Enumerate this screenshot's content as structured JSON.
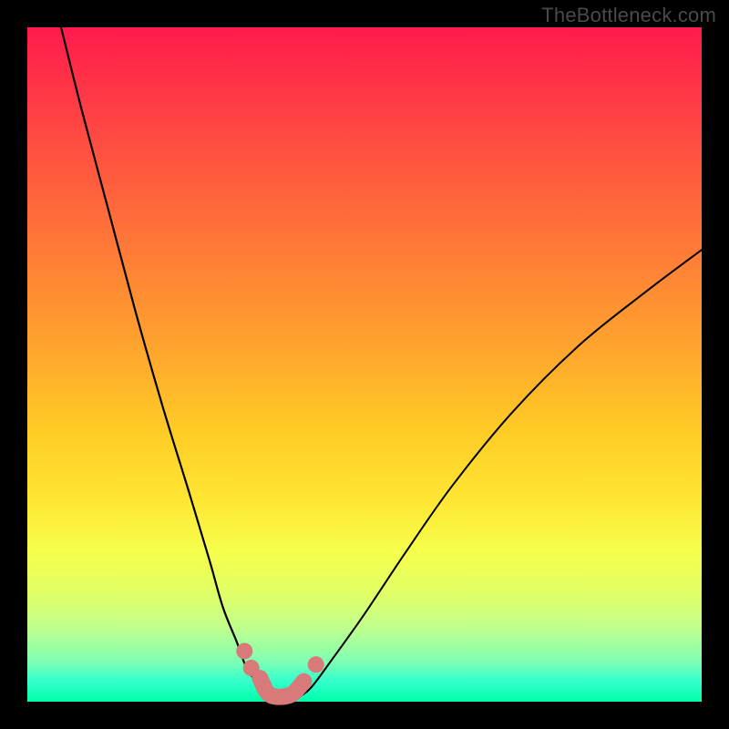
{
  "watermark": "TheBottleneck.com",
  "colors": {
    "background_frame": "#000000",
    "gradient_top": "#ff1a4d",
    "gradient_bottom": "#00ffaa",
    "curve": "#000000",
    "marker": "#d97a7a"
  },
  "chart_data": {
    "type": "line",
    "title": "",
    "xlabel": "",
    "ylabel": "",
    "xlim": [
      0,
      100
    ],
    "ylim": [
      0,
      100
    ],
    "grid": false,
    "legend": false,
    "annotations": [
      "TheBottleneck.com"
    ],
    "series": [
      {
        "name": "left-curve",
        "x": [
          5,
          8,
          12,
          16,
          20,
          24,
          27,
          29,
          31,
          32.5,
          34,
          35.5,
          37
        ],
        "y": [
          100,
          88,
          73,
          58,
          44,
          31,
          21,
          14,
          9,
          5,
          3,
          1.5,
          0.5
        ]
      },
      {
        "name": "right-curve",
        "x": [
          40,
          42,
          45,
          50,
          56,
          63,
          72,
          82,
          92,
          100
        ],
        "y": [
          0.5,
          2,
          6,
          13,
          22,
          32,
          43,
          53,
          61,
          67
        ]
      },
      {
        "name": "bottom-flat",
        "x": [
          37,
          40
        ],
        "y": [
          0.5,
          0.5
        ]
      }
    ],
    "markers": [
      {
        "name": "pink-bottom-u",
        "type": "path",
        "x": [
          34.5,
          36,
          39,
          41
        ],
        "y": [
          3.5,
          1,
          1,
          3
        ]
      },
      {
        "name": "pink-dot-left-upper",
        "type": "dot",
        "x": 32.2,
        "y": 7.5
      },
      {
        "name": "pink-dot-left-lower",
        "type": "dot",
        "x": 33.2,
        "y": 5.0
      },
      {
        "name": "pink-dot-right",
        "type": "dot",
        "x": 42.8,
        "y": 5.5
      }
    ]
  }
}
